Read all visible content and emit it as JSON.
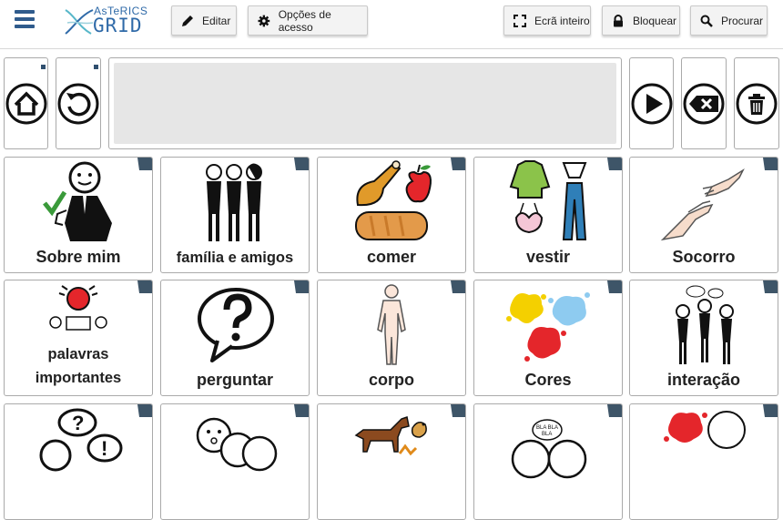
{
  "app": {
    "logo_top": "AsTeRICS",
    "logo_main": "GRID"
  },
  "toolbar": {
    "edit": "Editar",
    "access_options": "Opções de acesso",
    "fullscreen": "Ecrã inteiro",
    "lock": "Bloquear",
    "search": "Procurar"
  },
  "grid": {
    "row1": [
      "Sobre mim",
      "família e amigos",
      "comer",
      "vestir",
      "Socorro"
    ],
    "row2": [
      "palavras importantes",
      "perguntar",
      "corpo",
      "Cores",
      "interação"
    ]
  }
}
